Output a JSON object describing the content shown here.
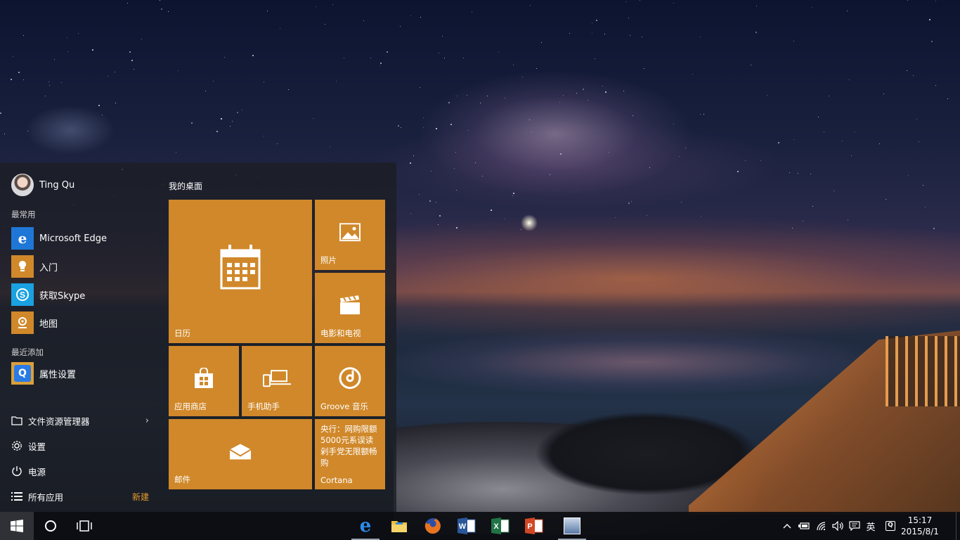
{
  "user": {
    "name": "Ting Qu"
  },
  "start_menu": {
    "most_used_label": "最常用",
    "most_used": [
      {
        "label": "Microsoft Edge",
        "icon": "edge-icon",
        "color": "#1e77d6"
      },
      {
        "label": "入门",
        "icon": "lightbulb-icon",
        "color": "#d0882a"
      },
      {
        "label": "获取Skype",
        "icon": "skype-icon",
        "color": "#1aa1e1"
      },
      {
        "label": "地图",
        "icon": "maps-icon",
        "color": "#d0882a"
      }
    ],
    "recently_added_label": "最近添加",
    "recently_added": [
      {
        "label": "属性设置",
        "icon": "qq-settings-icon",
        "color": "#2a7be6"
      }
    ],
    "system": {
      "file_explorer": "文件资源管理器",
      "settings": "设置",
      "power": "电源",
      "all_apps": "所有应用",
      "new_badge": "新建"
    },
    "group_title": "我的桌面",
    "tiles": {
      "calendar": "日历",
      "photos": "照片",
      "movies": "电影和电视",
      "store": "应用商店",
      "phone": "手机助手",
      "groove": "Groove 音乐",
      "mail": "邮件",
      "cortana_news": "央行：网购限额5000元系误读 剁手党无限额畅购",
      "cortana": "Cortana"
    },
    "tile_color": "#d0882a"
  },
  "taskbar": {
    "pinned": [
      {
        "name": "edge-taskbar-icon",
        "active": true
      },
      {
        "name": "file-explorer-taskbar-icon",
        "active": false
      },
      {
        "name": "firefox-taskbar-icon",
        "active": false
      },
      {
        "name": "word-taskbar-icon",
        "active": false
      },
      {
        "name": "excel-taskbar-icon",
        "active": false
      },
      {
        "name": "powerpoint-taskbar-icon",
        "active": false
      },
      {
        "name": "app-taskbar-icon",
        "active": true
      }
    ],
    "ime": "英",
    "time": "15:17",
    "date": "2015/8/1"
  }
}
